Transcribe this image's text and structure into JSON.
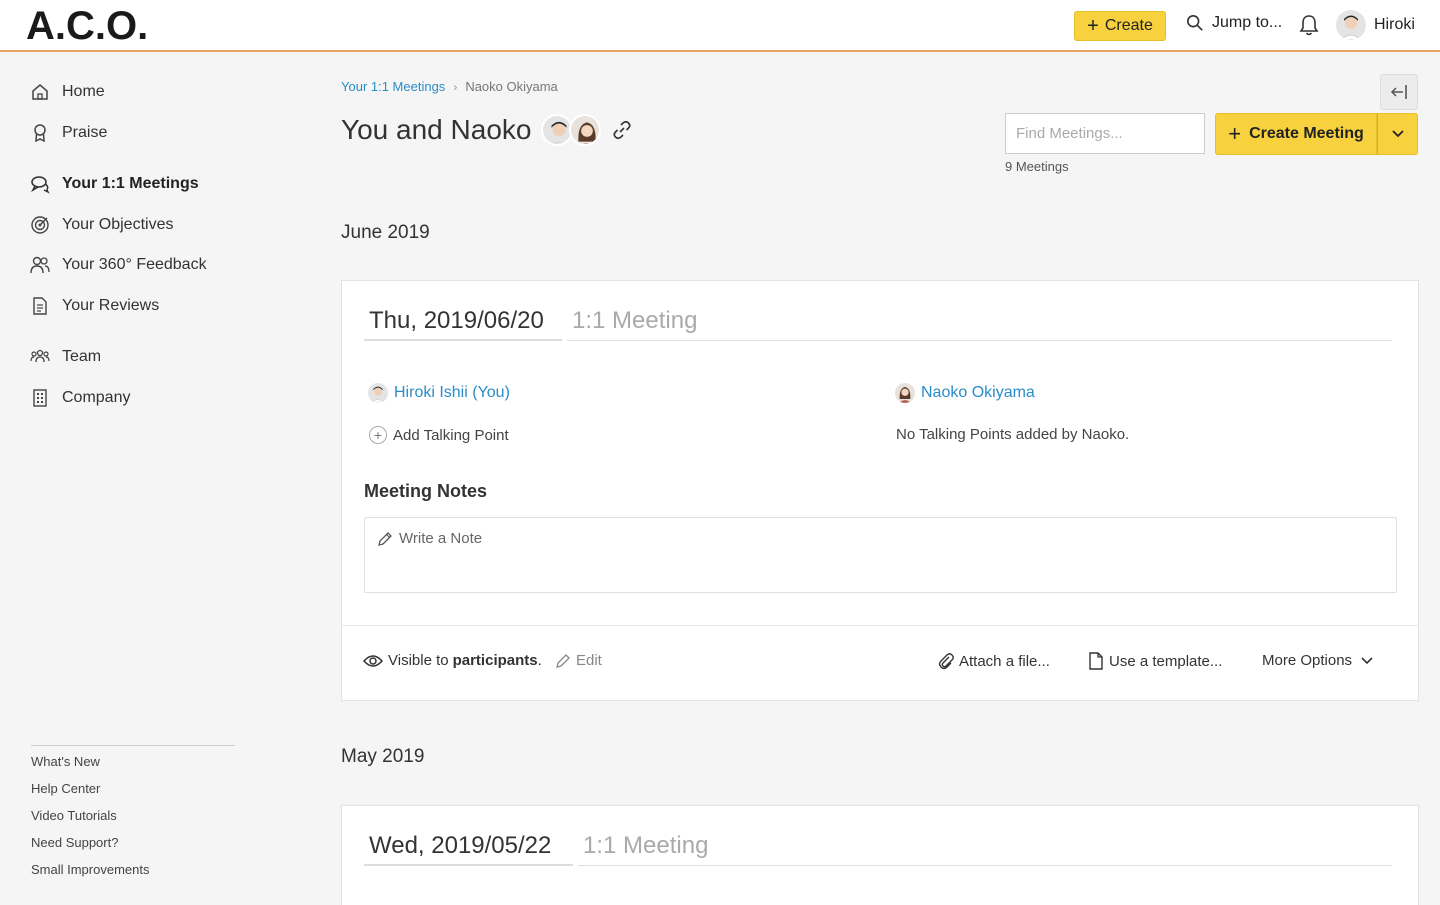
{
  "header": {
    "logo": "A.C.O.",
    "create_label": "Create",
    "jump_label": "Jump to...",
    "user_name": "Hiroki"
  },
  "sidebar": {
    "items": [
      {
        "label": "Home",
        "icon": "home-icon"
      },
      {
        "label": "Praise",
        "icon": "award-icon"
      },
      {
        "label": "Your 1:1 Meetings",
        "icon": "chat-icon",
        "active": true
      },
      {
        "label": "Your Objectives",
        "icon": "target-icon"
      },
      {
        "label": "Your 360° Feedback",
        "icon": "people-icon"
      },
      {
        "label": "Your Reviews",
        "icon": "document-icon"
      },
      {
        "label": "Team",
        "icon": "team-icon"
      },
      {
        "label": "Company",
        "icon": "building-icon"
      }
    ],
    "footer_links": [
      "What's New",
      "Help Center",
      "Video Tutorials",
      "Need Support?",
      "Small Improvements"
    ]
  },
  "breadcrumb": {
    "parent": "Your 1:1 Meetings",
    "current": "Naoko Okiyama"
  },
  "page": {
    "title": "You and Naoko",
    "find_placeholder": "Find Meetings...",
    "meetings_count": "9 Meetings",
    "create_meeting_label": "Create Meeting"
  },
  "months": [
    "June 2019",
    "May 2019"
  ],
  "meetings": [
    {
      "date": "Thu, 2019/06/20",
      "type": "1:1 Meeting",
      "participant_self": "Hiroki Ishii (You)",
      "participant_other": "Naoko Okiyama",
      "add_talking_point": "Add Talking Point",
      "no_talking_points": "No Talking Points added by Naoko.",
      "notes_title": "Meeting Notes",
      "notes_placeholder": "Write a Note",
      "visibility_prefix": "Visible to",
      "visibility_target": "participants",
      "visibility_suffix": ".",
      "edit_label": "Edit",
      "attach_label": "Attach a file...",
      "template_label": "Use a template...",
      "more_options_label": "More Options"
    },
    {
      "date": "Wed, 2019/05/22",
      "type": "1:1 Meeting"
    }
  ],
  "colors": {
    "accent_yellow": "#f7d23e",
    "link_blue": "#2a8cc8",
    "header_border": "#e8a562"
  }
}
